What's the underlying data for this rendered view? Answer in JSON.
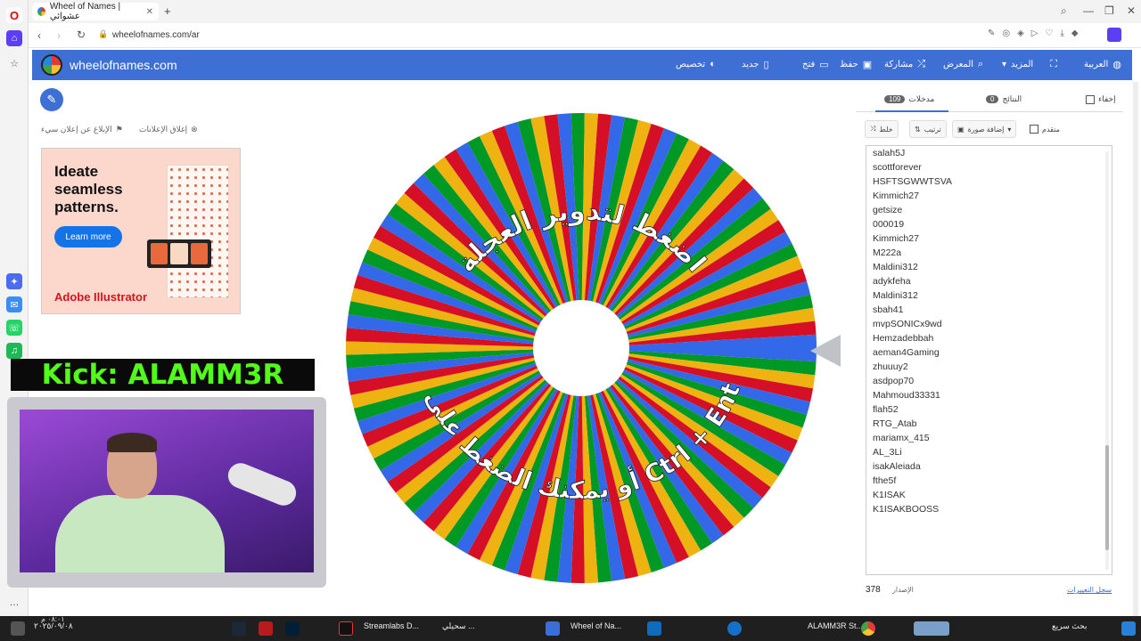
{
  "browser": {
    "tab_title": "Wheel of Names | عشوائي",
    "url": "wheelofnames.com/ar"
  },
  "site": {
    "brand": "wheelofnames.com",
    "nav": [
      "العربية",
      "المزيد",
      "المعرض",
      "مشاركة",
      "حفظ",
      "فتح",
      "جديد",
      "تخصيص"
    ]
  },
  "ad": {
    "report_label": "الإبلاغ عن إعلان سيء",
    "close_label": "إغلاق الإعلانات",
    "headline": "Ideate seamless patterns.",
    "button": "Learn more",
    "brand": "Adobe Illustrator"
  },
  "stream": {
    "kick_label": "Kick: ALAMM3R"
  },
  "wheel": {
    "hint_top": "اضغط لتدوير العجلة",
    "hint_bottom": "أو يمكنك الضغط على زر Ctrl + Enter",
    "colors": [
      "#3369e8",
      "#009925",
      "#eeb211",
      "#d50f25"
    ]
  },
  "panel": {
    "hide_label": "إخفاء",
    "results_label": "النتائج",
    "results_count": "0",
    "entries_label": "مدخلات",
    "entries_count": "109",
    "shuffle_label": "خلط",
    "sort_label": "ترتيب",
    "add_image_label": "إضافة صورة",
    "advanced_label": "متقدم",
    "entries": [
      "salah5J",
      "scottforever",
      "HSFTSGWWTSVA",
      "Kimmich27",
      "getsize",
      "000019",
      "Kimmich27",
      "M222a",
      "Maldini312",
      "adykfeha",
      "Maldini312",
      "sbah41",
      "mvpSONICx9wd",
      "Hemzadebbah",
      "aeman4Gaming",
      "zhuuuy2",
      "asdpop70",
      "Mahmoud33331",
      "flah52",
      "RTG_Atab",
      "mariamx_415",
      "AL_3Li",
      "isakAleiada",
      "fthe5f",
      "K1ISAK",
      "K1ISAKBOOSS"
    ],
    "version_label": "الإصدار",
    "version": "378",
    "changelog_label": "سجل التغييرات"
  },
  "taskbar": {
    "search": "بحث سريع",
    "apps": [
      "Streamlabs D...",
      "سحيلي ...",
      "Wheel of Na...",
      "ALAMM3R St..."
    ],
    "time": "٠٨:٠١ م",
    "date": "٢٠٢٥/٠٩/٠٨"
  }
}
